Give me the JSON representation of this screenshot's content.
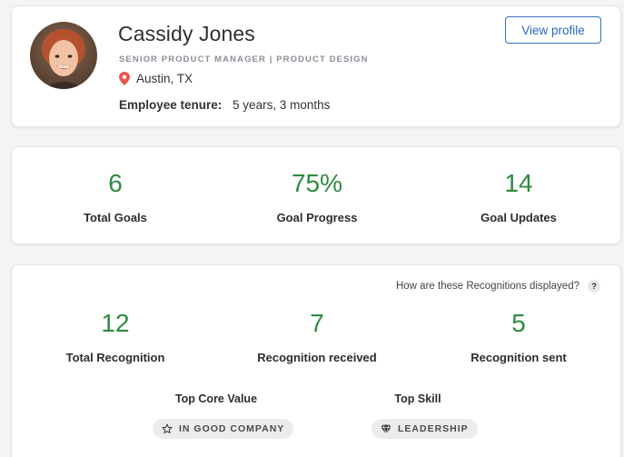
{
  "profile": {
    "name": "Cassidy Jones",
    "title": "SENIOR PRODUCT MANAGER | PRODUCT DESIGN",
    "location": "Austin, TX",
    "tenure_label": "Employee tenure:",
    "tenure_value": "5 years, 3 months",
    "view_profile_label": "View profile"
  },
  "goals": [
    {
      "value": "6",
      "label": "Total Goals"
    },
    {
      "value": "75%",
      "label": "Goal Progress"
    },
    {
      "value": "14",
      "label": "Goal Updates"
    }
  ],
  "recognitions": {
    "help_text": "How are these Recognitions displayed?",
    "help_icon": "?",
    "stats": [
      {
        "value": "12",
        "label": "Total Recognition"
      },
      {
        "value": "7",
        "label": "Recognition received"
      },
      {
        "value": "5",
        "label": "Recognition sent"
      }
    ],
    "top_core_value_label": "Top Core Value",
    "top_core_value": "IN GOOD COMPANY",
    "top_skill_label": "Top Skill",
    "top_skill": "LEADERSHIP"
  },
  "colors": {
    "accent_green": "#2e8b3f",
    "link_blue": "#2e66bd",
    "pin_red": "#e8574a"
  }
}
